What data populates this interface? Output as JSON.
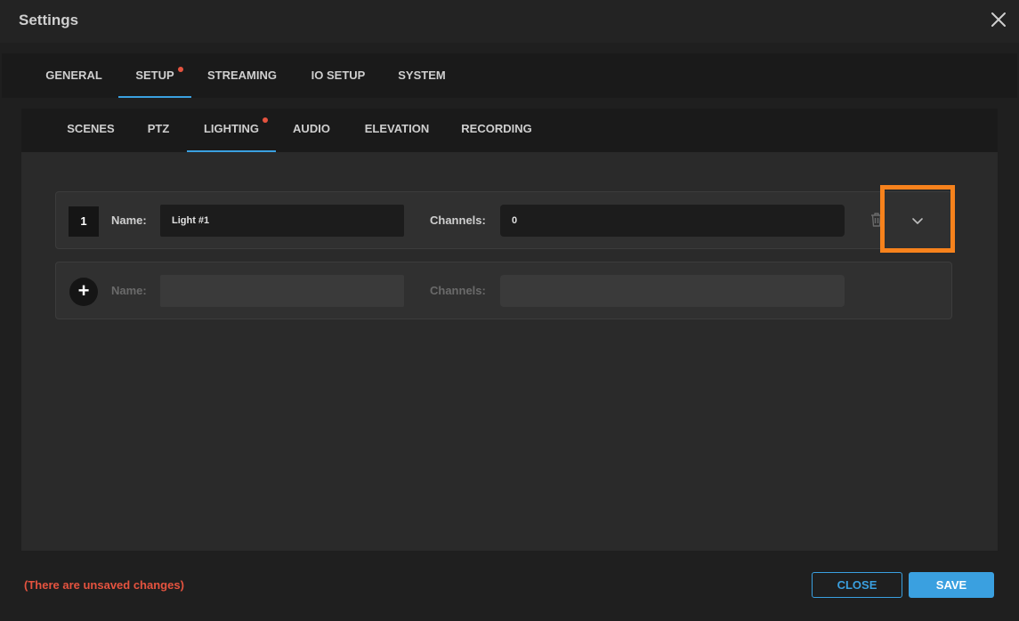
{
  "window": {
    "title": "Settings"
  },
  "main_tabs": [
    {
      "label": "GENERAL"
    },
    {
      "label": "SETUP"
    },
    {
      "label": "STREAMING"
    },
    {
      "label": "IO SETUP"
    },
    {
      "label": "SYSTEM"
    }
  ],
  "sub_tabs": [
    {
      "label": "SCENES"
    },
    {
      "label": "PTZ"
    },
    {
      "label": "LIGHTING"
    },
    {
      "label": "AUDIO"
    },
    {
      "label": "ELEVATION"
    },
    {
      "label": "RECORDING"
    }
  ],
  "lights": [
    {
      "number": "1",
      "name_label": "Name:",
      "name_value": "Light #1",
      "channels_label": "Channels:",
      "channels_value": "0"
    }
  ],
  "new_light": {
    "add_symbol": "+",
    "name_label": "Name:",
    "name_value": "",
    "channels_label": "Channels:",
    "channels_value": ""
  },
  "icons": {
    "close": "close-icon",
    "trash": "trash-icon",
    "expand": "chevron-down-icon",
    "add": "plus-icon"
  },
  "footer": {
    "unsaved_message": "(There are unsaved changes)",
    "close_label": "CLOSE",
    "save_label": "SAVE"
  },
  "colors": {
    "accent": "#3aa0e0",
    "warning": "#e5533f",
    "highlight": "#f7821c"
  }
}
